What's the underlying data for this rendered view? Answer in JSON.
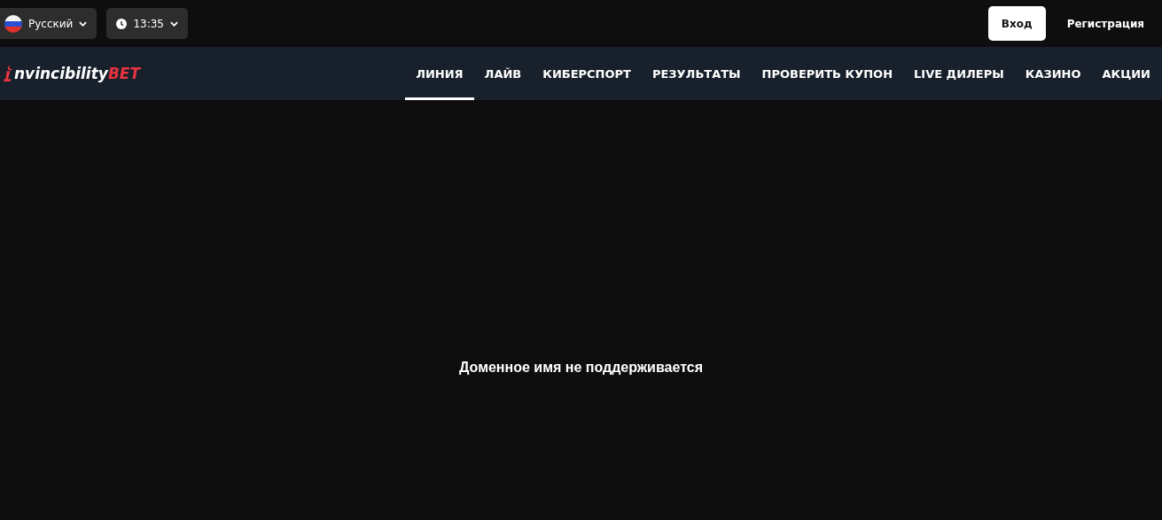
{
  "top_bar": {
    "language": "Русский",
    "time": "13:35",
    "login": "Вход",
    "register": "Регистрация"
  },
  "logo": {
    "text": "nvincibility",
    "accent": "BET"
  },
  "nav": [
    {
      "label": "ЛИНИЯ",
      "selected": true
    },
    {
      "label": "ЛАЙВ",
      "selected": false
    },
    {
      "label": "КИБЕРСПОРТ",
      "selected": false
    },
    {
      "label": "РЕЗУЛЬТАТЫ",
      "selected": false
    },
    {
      "label": "ПРОВЕРИТЬ КУПОН",
      "selected": false
    },
    {
      "label": "LIVE ДИЛЕРЫ",
      "selected": false
    },
    {
      "label": "КАЗИНО",
      "selected": false
    },
    {
      "label": "АКЦИИ",
      "selected": false
    }
  ],
  "message": "Доменное имя не поддерживается"
}
